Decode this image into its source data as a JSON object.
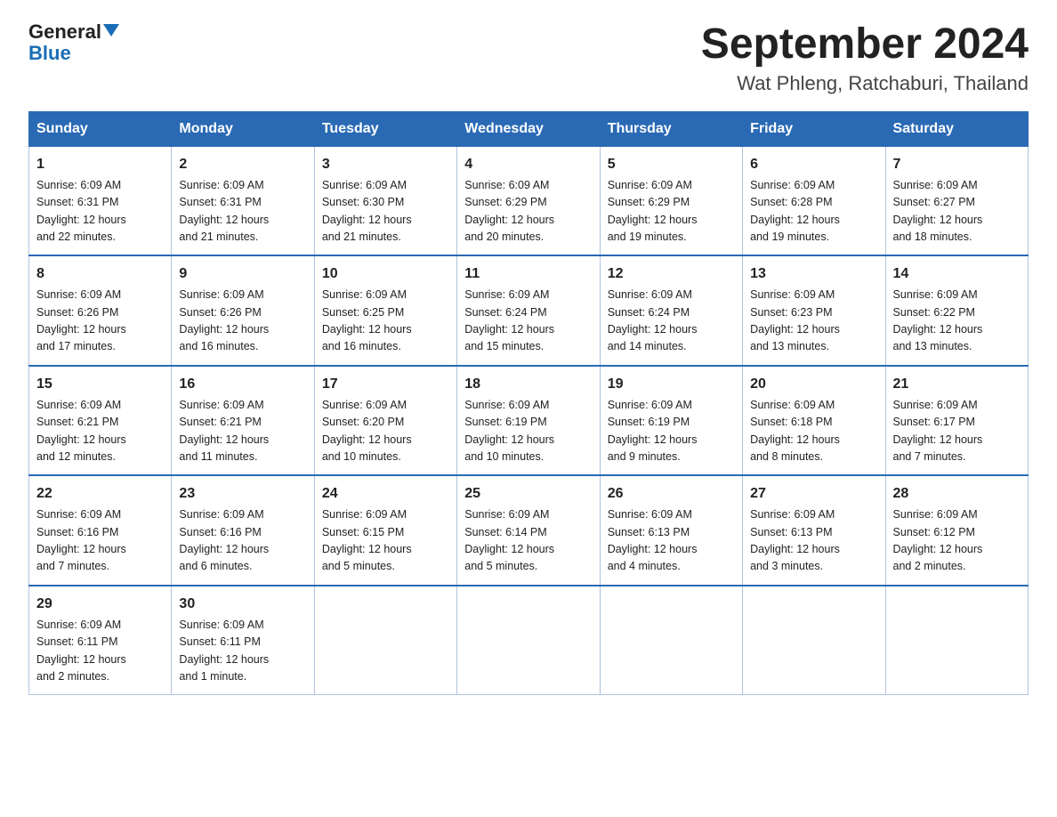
{
  "logo": {
    "text_general": "General",
    "text_blue": "Blue"
  },
  "header": {
    "title": "September 2024",
    "subtitle": "Wat Phleng, Ratchaburi, Thailand"
  },
  "weekdays": [
    "Sunday",
    "Monday",
    "Tuesday",
    "Wednesday",
    "Thursday",
    "Friday",
    "Saturday"
  ],
  "weeks": [
    [
      {
        "day": "1",
        "sunrise": "6:09 AM",
        "sunset": "6:31 PM",
        "daylight": "12 hours and 22 minutes."
      },
      {
        "day": "2",
        "sunrise": "6:09 AM",
        "sunset": "6:31 PM",
        "daylight": "12 hours and 21 minutes."
      },
      {
        "day": "3",
        "sunrise": "6:09 AM",
        "sunset": "6:30 PM",
        "daylight": "12 hours and 21 minutes."
      },
      {
        "day": "4",
        "sunrise": "6:09 AM",
        "sunset": "6:29 PM",
        "daylight": "12 hours and 20 minutes."
      },
      {
        "day": "5",
        "sunrise": "6:09 AM",
        "sunset": "6:29 PM",
        "daylight": "12 hours and 19 minutes."
      },
      {
        "day": "6",
        "sunrise": "6:09 AM",
        "sunset": "6:28 PM",
        "daylight": "12 hours and 19 minutes."
      },
      {
        "day": "7",
        "sunrise": "6:09 AM",
        "sunset": "6:27 PM",
        "daylight": "12 hours and 18 minutes."
      }
    ],
    [
      {
        "day": "8",
        "sunrise": "6:09 AM",
        "sunset": "6:26 PM",
        "daylight": "12 hours and 17 minutes."
      },
      {
        "day": "9",
        "sunrise": "6:09 AM",
        "sunset": "6:26 PM",
        "daylight": "12 hours and 16 minutes."
      },
      {
        "day": "10",
        "sunrise": "6:09 AM",
        "sunset": "6:25 PM",
        "daylight": "12 hours and 16 minutes."
      },
      {
        "day": "11",
        "sunrise": "6:09 AM",
        "sunset": "6:24 PM",
        "daylight": "12 hours and 15 minutes."
      },
      {
        "day": "12",
        "sunrise": "6:09 AM",
        "sunset": "6:24 PM",
        "daylight": "12 hours and 14 minutes."
      },
      {
        "day": "13",
        "sunrise": "6:09 AM",
        "sunset": "6:23 PM",
        "daylight": "12 hours and 13 minutes."
      },
      {
        "day": "14",
        "sunrise": "6:09 AM",
        "sunset": "6:22 PM",
        "daylight": "12 hours and 13 minutes."
      }
    ],
    [
      {
        "day": "15",
        "sunrise": "6:09 AM",
        "sunset": "6:21 PM",
        "daylight": "12 hours and 12 minutes."
      },
      {
        "day": "16",
        "sunrise": "6:09 AM",
        "sunset": "6:21 PM",
        "daylight": "12 hours and 11 minutes."
      },
      {
        "day": "17",
        "sunrise": "6:09 AM",
        "sunset": "6:20 PM",
        "daylight": "12 hours and 10 minutes."
      },
      {
        "day": "18",
        "sunrise": "6:09 AM",
        "sunset": "6:19 PM",
        "daylight": "12 hours and 10 minutes."
      },
      {
        "day": "19",
        "sunrise": "6:09 AM",
        "sunset": "6:19 PM",
        "daylight": "12 hours and 9 minutes."
      },
      {
        "day": "20",
        "sunrise": "6:09 AM",
        "sunset": "6:18 PM",
        "daylight": "12 hours and 8 minutes."
      },
      {
        "day": "21",
        "sunrise": "6:09 AM",
        "sunset": "6:17 PM",
        "daylight": "12 hours and 7 minutes."
      }
    ],
    [
      {
        "day": "22",
        "sunrise": "6:09 AM",
        "sunset": "6:16 PM",
        "daylight": "12 hours and 7 minutes."
      },
      {
        "day": "23",
        "sunrise": "6:09 AM",
        "sunset": "6:16 PM",
        "daylight": "12 hours and 6 minutes."
      },
      {
        "day": "24",
        "sunrise": "6:09 AM",
        "sunset": "6:15 PM",
        "daylight": "12 hours and 5 minutes."
      },
      {
        "day": "25",
        "sunrise": "6:09 AM",
        "sunset": "6:14 PM",
        "daylight": "12 hours and 5 minutes."
      },
      {
        "day": "26",
        "sunrise": "6:09 AM",
        "sunset": "6:13 PM",
        "daylight": "12 hours and 4 minutes."
      },
      {
        "day": "27",
        "sunrise": "6:09 AM",
        "sunset": "6:13 PM",
        "daylight": "12 hours and 3 minutes."
      },
      {
        "day": "28",
        "sunrise": "6:09 AM",
        "sunset": "6:12 PM",
        "daylight": "12 hours and 2 minutes."
      }
    ],
    [
      {
        "day": "29",
        "sunrise": "6:09 AM",
        "sunset": "6:11 PM",
        "daylight": "12 hours and 2 minutes."
      },
      {
        "day": "30",
        "sunrise": "6:09 AM",
        "sunset": "6:11 PM",
        "daylight": "12 hours and 1 minute."
      },
      null,
      null,
      null,
      null,
      null
    ]
  ],
  "labels": {
    "sunrise": "Sunrise:",
    "sunset": "Sunset:",
    "daylight": "Daylight:"
  }
}
